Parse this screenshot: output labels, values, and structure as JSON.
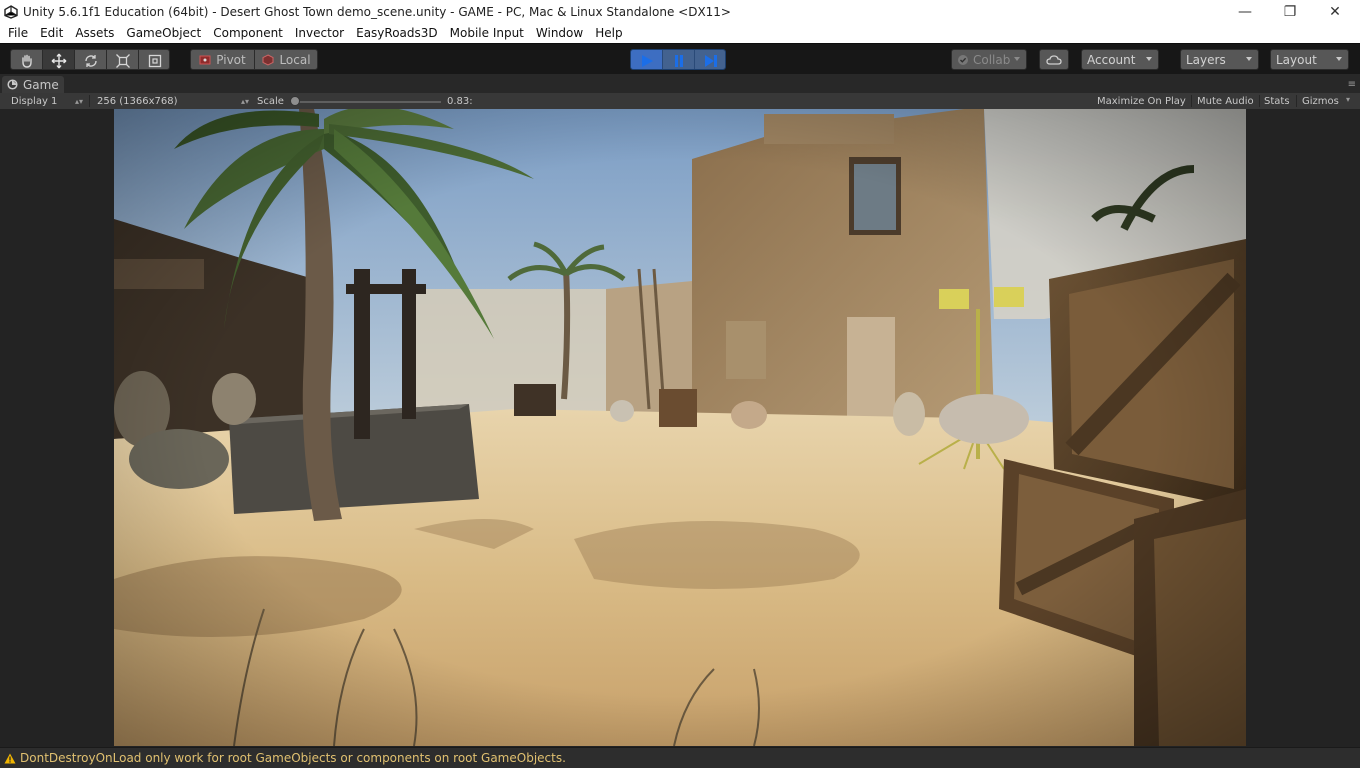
{
  "window": {
    "title": "Unity 5.6.1f1 Education (64bit) - Desert Ghost Town demo_scene.unity - GAME - PC, Mac & Linux Standalone <DX11>",
    "minimize_glyph": "—",
    "restore_glyph": "❐",
    "close_glyph": "✕"
  },
  "menu": [
    "File",
    "Edit",
    "Assets",
    "GameObject",
    "Component",
    "Invector",
    "EasyRoads3D",
    "Mobile Input",
    "Window",
    "Help"
  ],
  "toolbar": {
    "pivot_label": "Pivot",
    "local_label": "Local",
    "collab_label": "Collab",
    "account_label": "Account",
    "layers_label": "Layers",
    "layout_label": "Layout",
    "play_state": "playing"
  },
  "game_tab": {
    "label": "Game"
  },
  "game_bar": {
    "display": "Display 1",
    "resolution": "256 (1366x768)",
    "scale_label": "Scale",
    "scale_value": "0.83:",
    "maximize_on_play": "Maximize On Play",
    "mute_audio": "Mute Audio",
    "stats": "Stats",
    "gizmos": "Gizmos"
  },
  "status": {
    "message": "DontDestroyOnLoad only work for root GameObjects or components on root GameObjects.",
    "warning_color": "#f0b400"
  },
  "colors": {
    "play_accent": "#3d6ec2",
    "editor_bg": "#383838"
  }
}
